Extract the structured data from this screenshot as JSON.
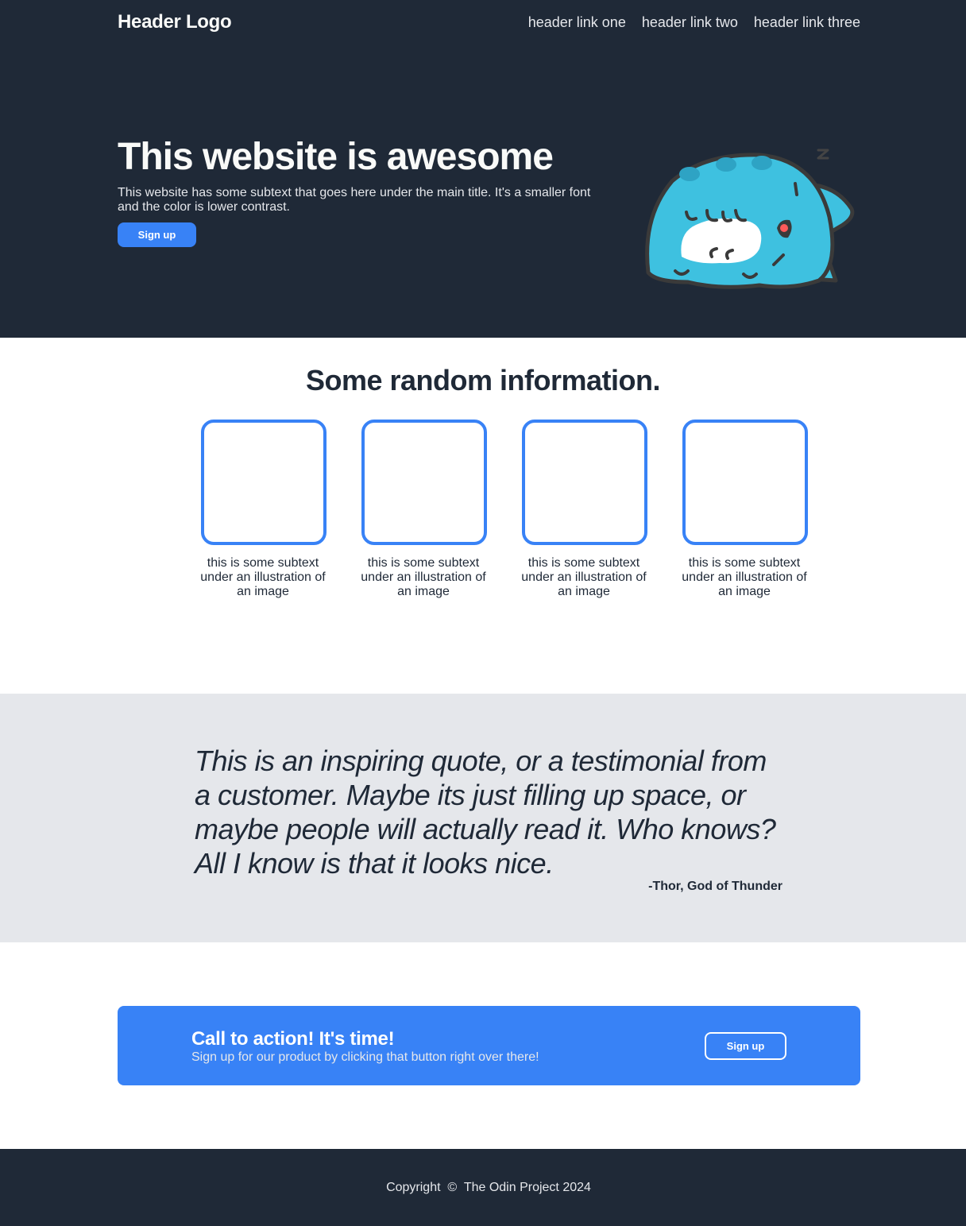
{
  "header": {
    "logo": "Header Logo",
    "links": [
      "header link one",
      "header link two",
      "header link three"
    ]
  },
  "hero": {
    "title": "This website is awesome",
    "subtitle": "This website has some subtext that goes here under the main title. It's a smaller font and the color is lower contrast.",
    "button_label": "Sign up",
    "mascot_icon": "sleeping-blue-monster-illustration"
  },
  "info": {
    "title": "Some random information.",
    "cards": [
      {
        "text": "this is some subtext under an illustration of an image"
      },
      {
        "text": "this is some subtext under an illustration of an image"
      },
      {
        "text": "this is some subtext under an illustration of an image"
      },
      {
        "text": "this is some subtext under an illustration of an image"
      }
    ]
  },
  "quote": {
    "text": "This is an inspiring quote, or a testimonial from a customer. Maybe its just filling up space, or maybe people will actually read it. Who knows? All I know is that it looks nice.",
    "author": "-Thor, God of Thunder"
  },
  "cta": {
    "title": "Call to action! It's time!",
    "subtitle": "Sign up for our product by clicking that button right over there!",
    "button_label": "Sign up"
  },
  "footer": {
    "text": "Copyright  ©  The Odin Project 2024"
  },
  "colors": {
    "dark": "#1f2937",
    "accent": "#3882f6",
    "light_gray": "#e5e7eb",
    "offwhite": "#f9faf8"
  }
}
